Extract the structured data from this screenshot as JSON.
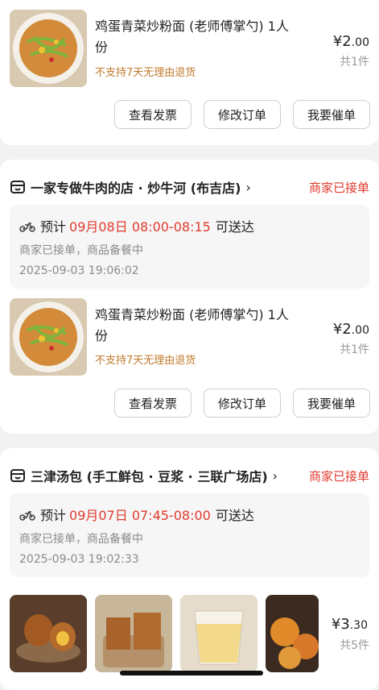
{
  "orders": [
    {
      "item": {
        "name": "鸡蛋青菜炒粉面 (老师傅掌勺) 1人份",
        "note": "不支持7天无理由退货",
        "price_main": "¥2",
        "price_dec": ".00",
        "count": "共1件"
      },
      "buttons": [
        "查看发票",
        "修改订单",
        "我要催单"
      ]
    },
    {
      "store": "一家专做牛肉的店 · 炒牛河 (布吉店)",
      "status": "商家已接单",
      "eta_label": "预计",
      "eta_time": "09月08日 08:00-08:15",
      "eta_tail": "可送达",
      "sub_status": "商家已接单，商品备餐中",
      "timestamp": "2025-09-03 19:06:02",
      "item": {
        "name": "鸡蛋青菜炒粉面 (老师傅掌勺) 1人份",
        "note": "不支持7天无理由退货",
        "price_main": "¥2",
        "price_dec": ".00",
        "count": "共1件"
      },
      "buttons": [
        "查看发票",
        "修改订单",
        "我要催单"
      ]
    },
    {
      "store": "三津汤包 (手工鲜包 · 豆浆 · 三联广场店)",
      "status": "商家已接单",
      "eta_label": "预计",
      "eta_time": "09月07日 07:45-08:00",
      "eta_tail": "可送达",
      "sub_status": "商家已接单，商品备餐中",
      "timestamp": "2025-09-03 19:02:33",
      "summary": {
        "price_main": "¥3",
        "price_dec": ".30",
        "count": "共5件"
      }
    }
  ],
  "icons": {
    "store": "store-icon",
    "scooter": "scooter-icon",
    "chevron": "chevron-right-icon"
  },
  "colors": {
    "accent": "#e03a2f",
    "note": "#c07a2c"
  }
}
